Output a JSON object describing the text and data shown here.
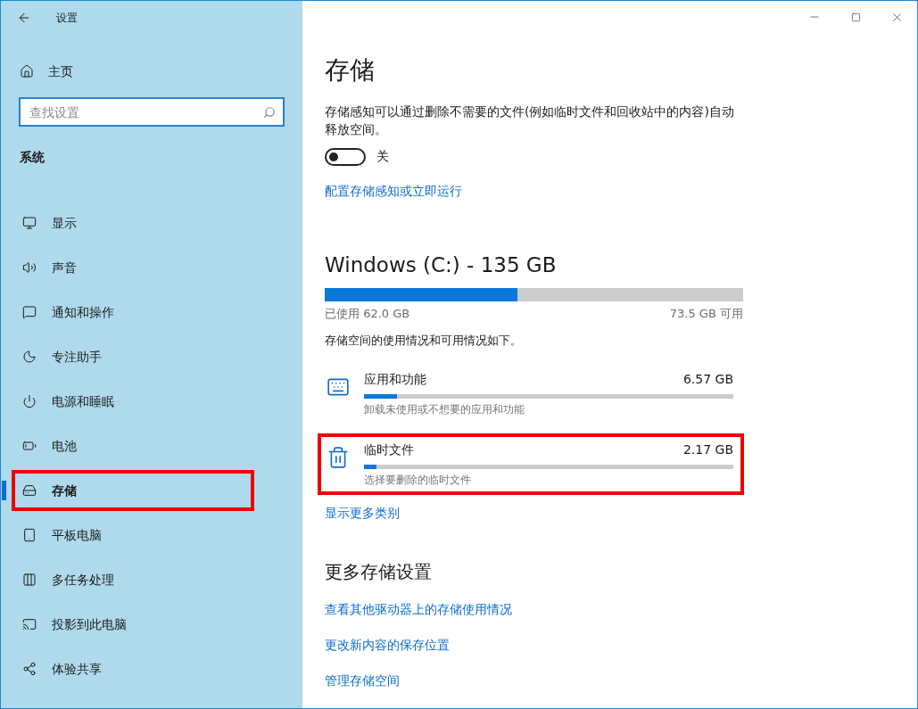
{
  "window": {
    "title": "设置"
  },
  "sidebar": {
    "home": "主页",
    "search": {
      "placeholder": "查找设置"
    },
    "section": "系统",
    "items": [
      {
        "label": "显示",
        "selected": false,
        "highlighted": false
      },
      {
        "label": "声音",
        "selected": false,
        "highlighted": false
      },
      {
        "label": "通知和操作",
        "selected": false,
        "highlighted": false
      },
      {
        "label": "专注助手",
        "selected": false,
        "highlighted": false
      },
      {
        "label": "电源和睡眠",
        "selected": false,
        "highlighted": false
      },
      {
        "label": "电池",
        "selected": false,
        "highlighted": false
      },
      {
        "label": "存储",
        "selected": true,
        "highlighted": true
      },
      {
        "label": "平板电脑",
        "selected": false,
        "highlighted": false
      },
      {
        "label": "多任务处理",
        "selected": false,
        "highlighted": false
      },
      {
        "label": "投影到此电脑",
        "selected": false,
        "highlighted": false
      },
      {
        "label": "体验共享",
        "selected": false,
        "highlighted": false
      }
    ]
  },
  "main": {
    "title": "存储",
    "description": "存储感知可以通过删除不需要的文件(例如临时文件和回收站中的内容)自动释放空间。",
    "storage_sense": {
      "on": false,
      "label": "关"
    },
    "configure_link": "配置存储感知或立即运行",
    "drive": {
      "title": "Windows (C:) - 135 GB",
      "level": 0.46,
      "used": "已使用 62.0 GB",
      "free": "73.5 GB 可用"
    },
    "usage_text": "存储空间的使用情况和可用情况如下。",
    "categories": [
      {
        "name": "应用和功能",
        "size": "6.57 GB",
        "level": 0.09,
        "hint": "卸载未使用或不想要的应用和功能",
        "highlighted": false
      },
      {
        "name": "临时文件",
        "size": "2.17 GB",
        "level": 0.035,
        "hint": "选择要删除的临时文件",
        "highlighted": true
      }
    ],
    "show_more": "显示更多类别",
    "more_title": "更多存储设置",
    "more_links": [
      "查看其他驱动器上的存储使用情况",
      "更改新内容的保存位置",
      "管理存储空间"
    ]
  }
}
